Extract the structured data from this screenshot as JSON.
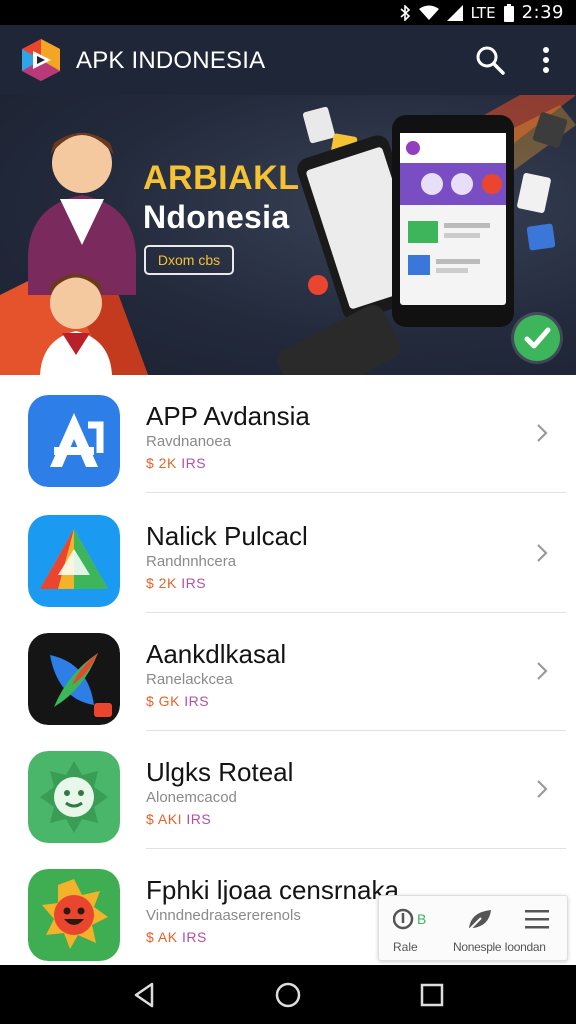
{
  "status_bar": {
    "network": "LTE",
    "time": "2:39"
  },
  "app_bar": {
    "title": "APK INDONESIA",
    "icons": [
      "app-logo-icon",
      "search-icon",
      "more-vert-icon"
    ]
  },
  "banner": {
    "title": "ARBIAKL",
    "subtitle": "Ndonesia",
    "button_label": "Dxom cbs"
  },
  "apps": [
    {
      "name": "APP Avdansia",
      "meta": "Ravdnanoea",
      "price": "$ 2K ",
      "price_tail": "IRS",
      "icon": "app-store-a-icon",
      "icon_colors": [
        "#2d7ee6",
        "#1c5fc4"
      ]
    },
    {
      "name": "Nalick Pulcacl",
      "meta": "Randnnhcera",
      "price": "$ 2K ",
      "price_tail": "IRS",
      "icon": "colorful-triangle-icon",
      "icon_colors": [
        "#1a9af0",
        "#f2b32a"
      ]
    },
    {
      "name": "Aankdlkasal",
      "meta": "Ranelackcea",
      "price": "$ GK ",
      "price_tail": "IRS",
      "icon": "feather-logo-icon",
      "icon_colors": [
        "#151515",
        "#e9452f"
      ]
    },
    {
      "name": "Ulgks Roteal",
      "meta": "Alonemcacod",
      "price": "$ AKI ",
      "price_tail": "IRS",
      "icon": "green-star-face-icon",
      "icon_colors": [
        "#49b66a",
        "#2f9b50"
      ]
    },
    {
      "name": "Fphki ljoaa censrnaka",
      "meta": "Vinndnedraasererenols",
      "price": "$ AK ",
      "price_tail": "IRS",
      "icon": "red-star-face-icon",
      "icon_colors": [
        "#3fae52",
        "#e9452f"
      ]
    }
  ],
  "bottom_panel": {
    "label_left": "Rale",
    "label_right": "Nonesple Ioondan",
    "icons": [
      "toggle-icon",
      "leaf-icon",
      "menu-icon"
    ]
  },
  "nav_bar": {
    "icons": [
      "back-icon",
      "home-icon",
      "recents-icon"
    ]
  },
  "colors": {
    "app_bar": "#1f2638",
    "banner_title": "#f4c232",
    "check_badge": "#3cb55b",
    "price": "#e6632a",
    "price_tail": "#b34fa6"
  }
}
